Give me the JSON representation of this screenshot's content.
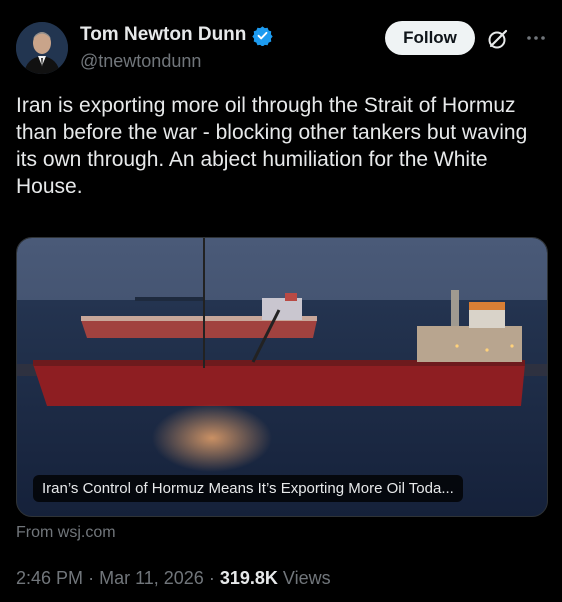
{
  "author": {
    "name": "Tom Newton Dunn",
    "handle": "@tnewtondunn",
    "verified": true
  },
  "actions": {
    "follow_label": "Follow",
    "grok_icon": "grok-icon",
    "more_icon": "more-options-icon"
  },
  "tweet": {
    "text": "Iran is exporting more oil through the Strait of Hormuz than before the war - blocking other tankers but waving its own through. An abject humiliation for the White House."
  },
  "link_card": {
    "title": "Iran’s Control of Hormuz Means It’s Exporting More Oil Toda...",
    "source": "From wsj.com"
  },
  "meta": {
    "time": "2:46 PM",
    "separator": "·",
    "date": "Mar 11, 2026",
    "views_count": "319.8K",
    "views_label": "Views"
  },
  "colors": {
    "background": "#000000",
    "text": "#e7e9ea",
    "secondary": "#71767b",
    "verified": "#1d9bf0",
    "button_bg": "#eff3f4"
  }
}
